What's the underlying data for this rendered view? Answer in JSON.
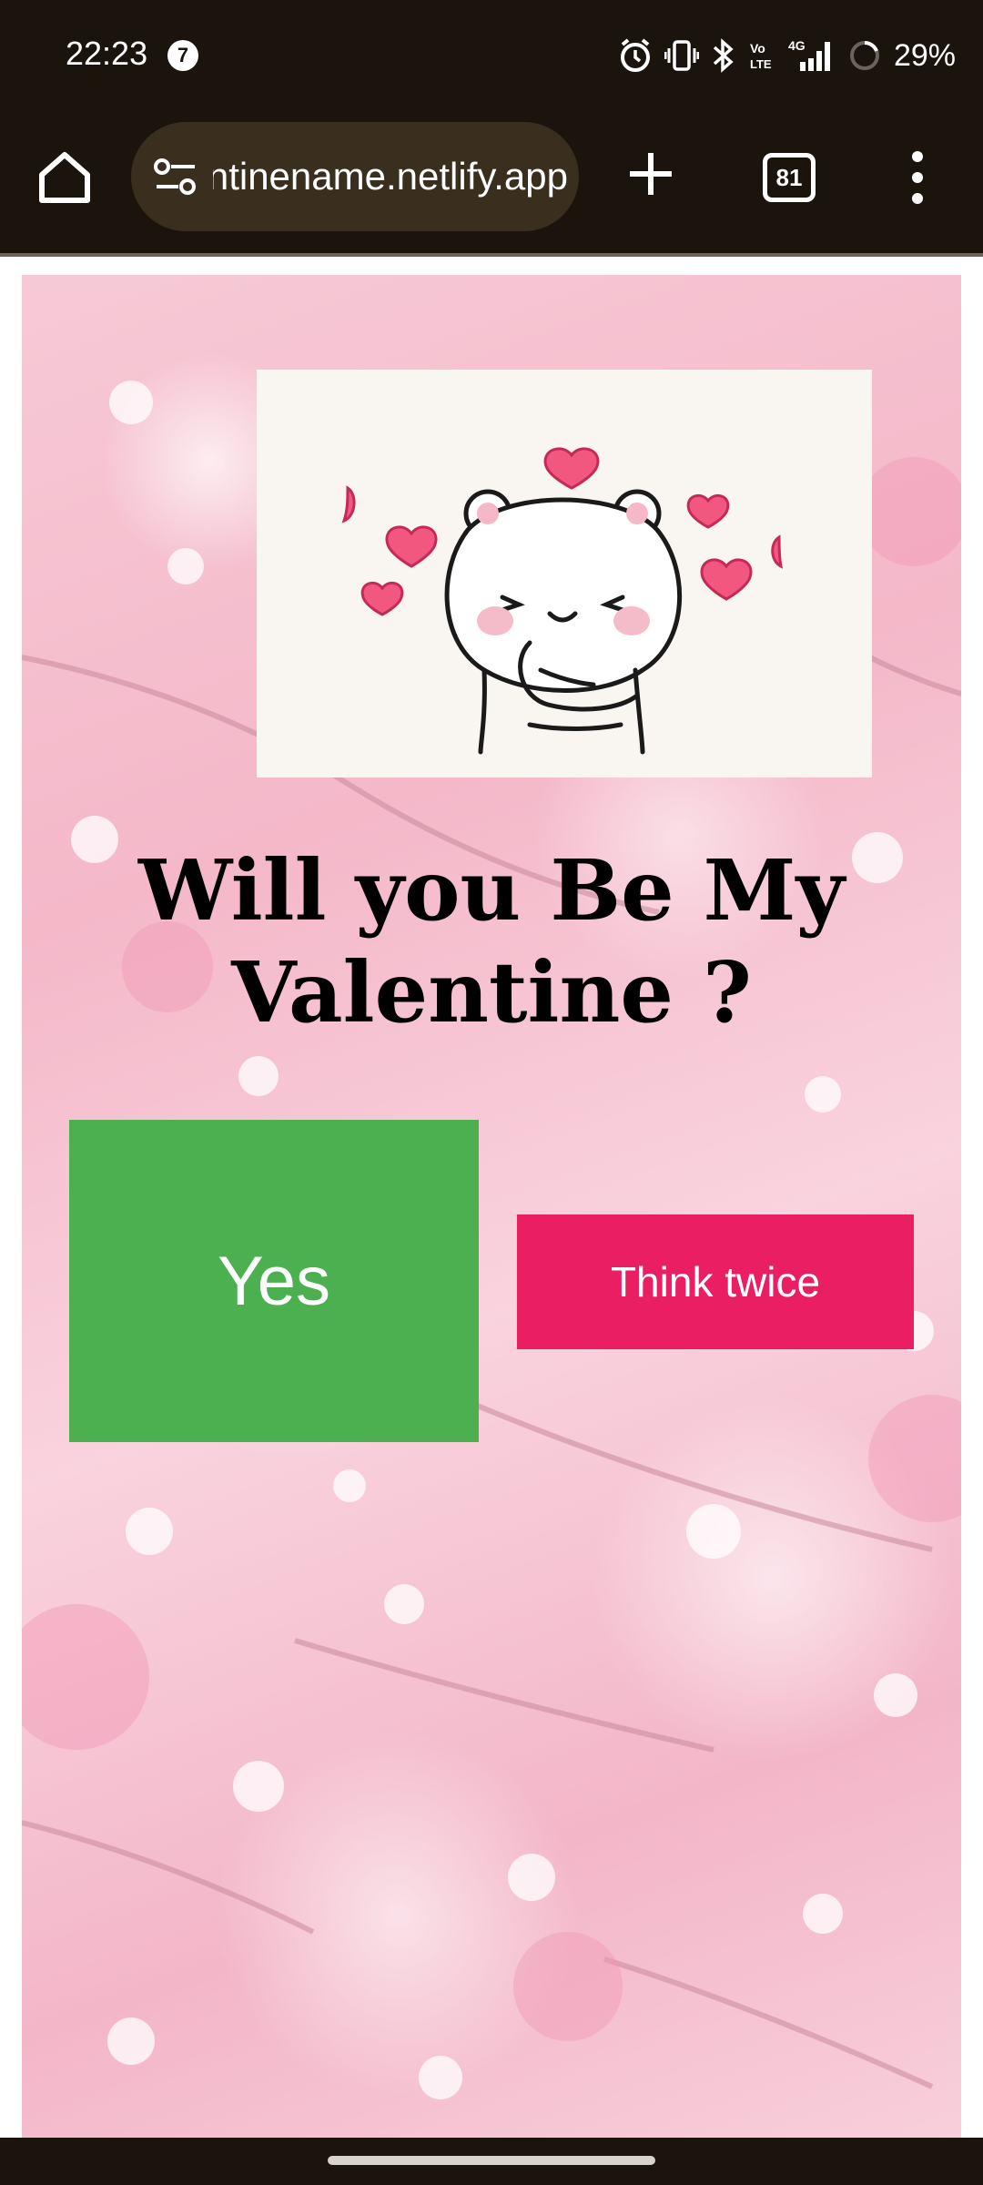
{
  "status_bar": {
    "time": "22:23",
    "notification_count": "7",
    "network": "4G",
    "battery": "29%",
    "icons": [
      "alarm-icon",
      "vibrate-icon",
      "bluetooth-icon",
      "volte-icon",
      "signal-icon",
      "battery-icon"
    ]
  },
  "browser": {
    "url": "valentinename.netlify.app",
    "tab_count": "81",
    "icons": [
      "home-icon",
      "site-settings-icon",
      "new-tab-icon",
      "tab-switcher-icon",
      "overflow-menu-icon"
    ]
  },
  "page": {
    "title": "Will you Be My Valentine ?",
    "yes_label": "Yes",
    "think_label": "Think twice",
    "colors": {
      "yes": "#4caf50",
      "think": "#e91e63",
      "background": "#f7c9d6"
    }
  }
}
